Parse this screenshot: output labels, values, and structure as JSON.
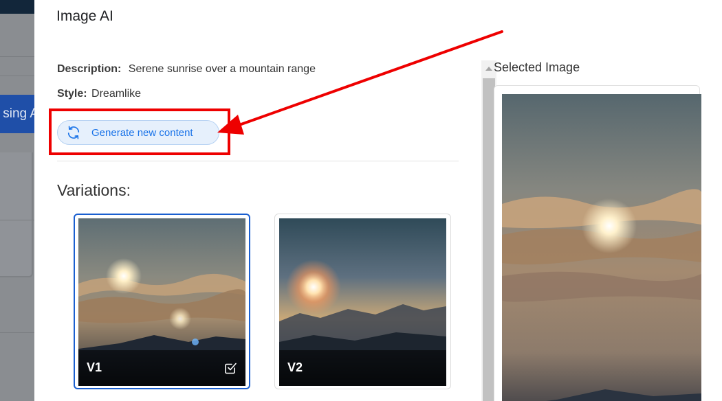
{
  "background_app": {
    "button_label_fragment": "sing A"
  },
  "modal": {
    "title": "Image AI",
    "description_label": "Description:",
    "description_value": "Serene sunrise over a mountain range",
    "style_label": "Style:",
    "style_value": "Dreamlike",
    "generate_button_label": "Generate new content",
    "variations_title": "Variations:",
    "variations": [
      {
        "label": "V1",
        "selected": true
      },
      {
        "label": "V2",
        "selected": false
      }
    ],
    "selected_title": "Selected Image"
  },
  "icons": {
    "generate": "refresh-icon",
    "checkbox": "checkbox-checked-icon",
    "scroll_up": "caret-up-icon"
  },
  "colors": {
    "accent": "#1a73e8",
    "selected_border": "#1a5fd0",
    "annotation": "#ee0000",
    "background_button": "#1f4fa8"
  }
}
